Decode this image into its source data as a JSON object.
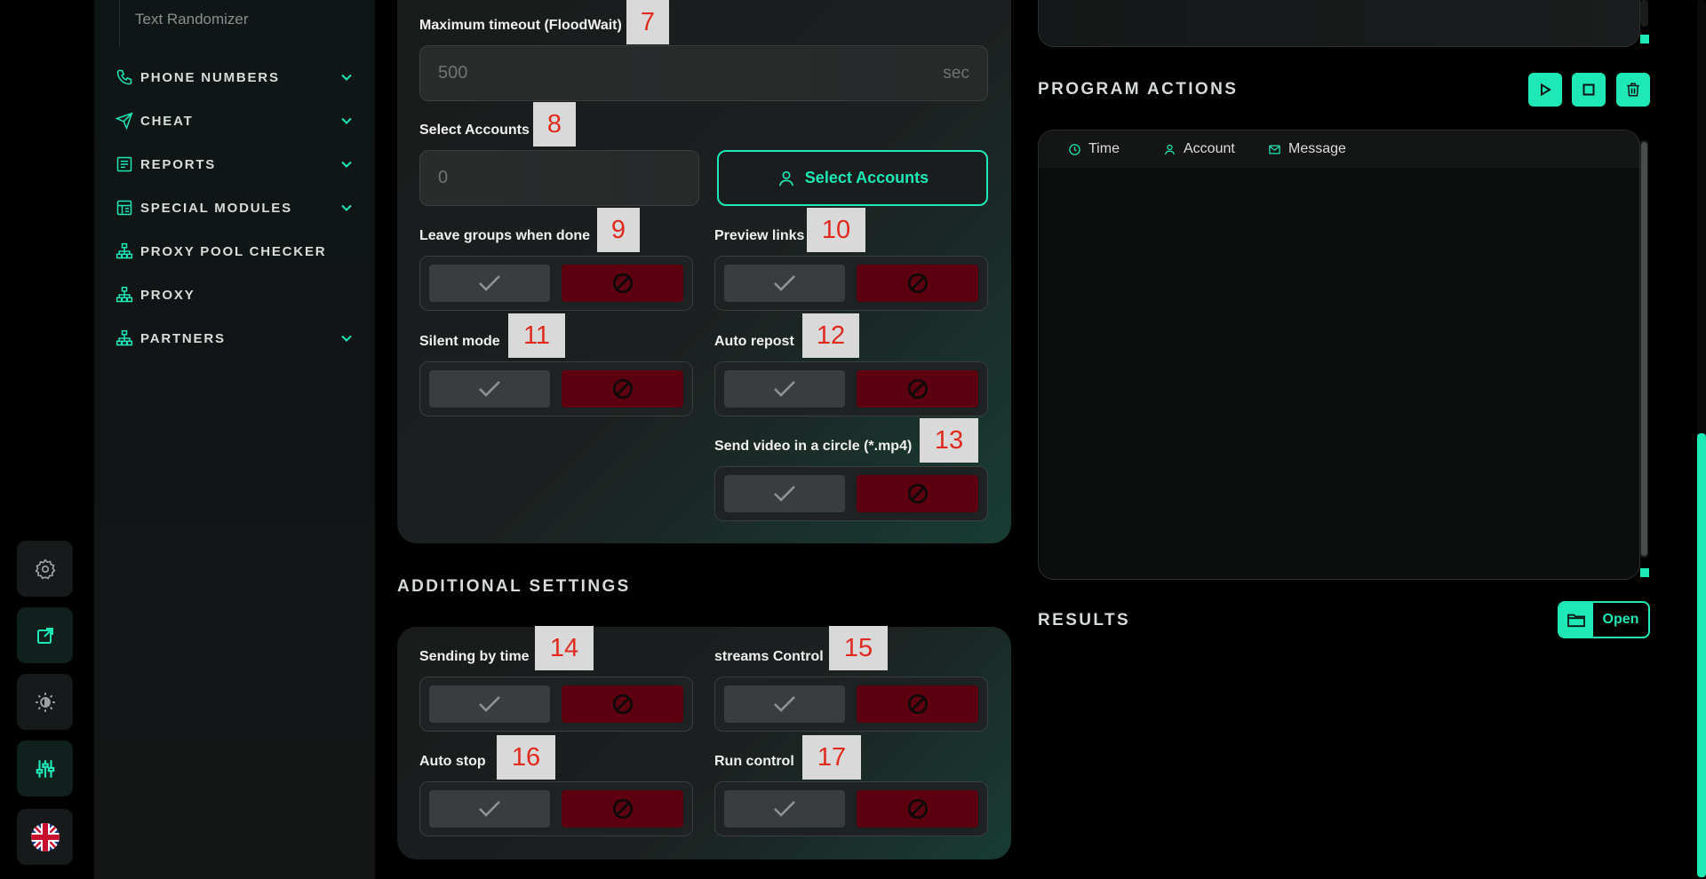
{
  "sidebar": {
    "sub_item": "Text Randomizer",
    "items": [
      {
        "label": "PHONE NUMBERS",
        "icon": "phone-icon",
        "expandable": true
      },
      {
        "label": "CHEAT",
        "icon": "send-icon",
        "expandable": true
      },
      {
        "label": "REPORTS",
        "icon": "report-icon",
        "expandable": true
      },
      {
        "label": "SPECIAL MODULES",
        "icon": "modules-icon",
        "expandable": true
      },
      {
        "label": "PROXY POOL CHECKER",
        "icon": "network-icon",
        "expandable": false
      },
      {
        "label": "PROXY",
        "icon": "network-icon",
        "expandable": false
      },
      {
        "label": "PARTNERS",
        "icon": "network-icon",
        "expandable": true
      }
    ]
  },
  "rail": {
    "buttons": [
      "gear-icon",
      "external-link-icon",
      "theme-icon",
      "sliders-icon",
      "uk-flag-icon"
    ]
  },
  "settings": {
    "max_timeout_label": "Maximum timeout (FloodWait)",
    "max_timeout_tag": "7",
    "max_timeout_value": "500",
    "max_timeout_suffix": "sec",
    "select_accounts_label": "Select Accounts",
    "select_accounts_tag": "8",
    "select_accounts_value": "0",
    "select_accounts_button": "Select Accounts",
    "leave_groups_label": "Leave groups when done",
    "leave_groups_tag": "9",
    "preview_links_label": "Preview links",
    "preview_links_tag": "10",
    "silent_mode_label": "Silent mode",
    "silent_mode_tag": "11",
    "auto_repost_label": "Auto repost",
    "auto_repost_tag": "12",
    "send_video_label": "Send video in a circle (*.mp4)",
    "send_video_tag": "13"
  },
  "additional": {
    "title": "ADDITIONAL SETTINGS",
    "sending_by_time_label": "Sending by time",
    "sending_by_time_tag": "14",
    "streams_control_label": "streams Control",
    "streams_control_tag": "15",
    "auto_stop_label": "Auto stop",
    "auto_stop_tag": "16",
    "run_control_label": "Run control",
    "run_control_tag": "17"
  },
  "program_actions": {
    "title": "PROGRAM ACTIONS",
    "columns": [
      "Time",
      "Account",
      "Message"
    ]
  },
  "results": {
    "title": "RESULTS",
    "open_label": "Open"
  },
  "colors": {
    "accent": "#1ee8b6",
    "danger": "#5c0010",
    "tag_text": "#e02a1f"
  }
}
